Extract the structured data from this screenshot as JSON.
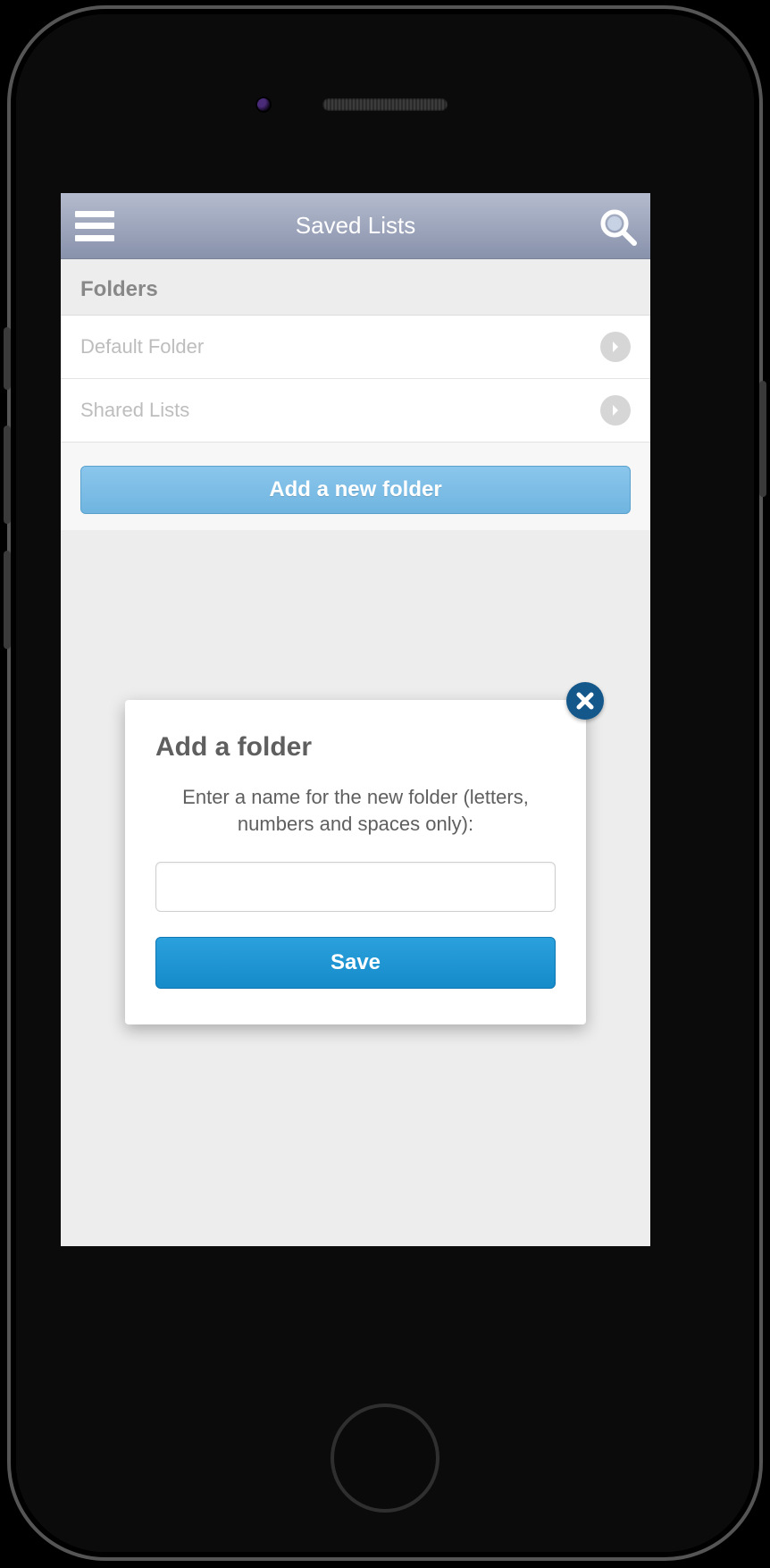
{
  "navbar": {
    "title": "Saved Lists"
  },
  "section": {
    "header": "Folders"
  },
  "folders": [
    {
      "label": "Default Folder"
    },
    {
      "label": "Shared Lists"
    }
  ],
  "add_button": {
    "label": "Add a new folder"
  },
  "dialog": {
    "title": "Add a folder",
    "instruction": "Enter a name for the new folder (letters, numbers and spaces only):",
    "input_value": "",
    "save_label": "Save"
  }
}
